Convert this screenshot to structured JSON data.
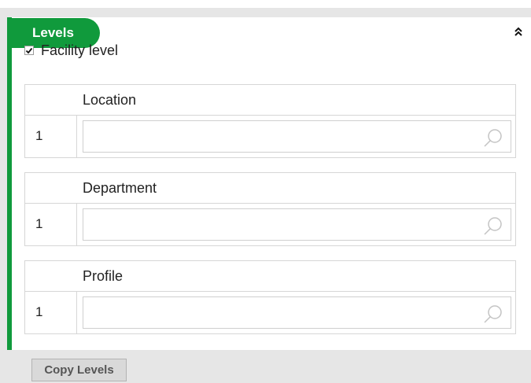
{
  "panel": {
    "title": "Levels",
    "collapse_icon": "double-chevron-up-icon"
  },
  "facility_level": {
    "label": "Facility level",
    "checked": true
  },
  "levels": [
    {
      "header": "Location",
      "row_number": "1",
      "value": "",
      "search_icon": "search-icon"
    },
    {
      "header": "Department",
      "row_number": "1",
      "value": "",
      "search_icon": "search-icon"
    },
    {
      "header": "Profile",
      "row_number": "1",
      "value": "",
      "search_icon": "search-icon"
    }
  ],
  "footer": {
    "copy_levels_label": "Copy Levels"
  },
  "colors": {
    "accent": "#109a3c",
    "background": "#e6e6e6",
    "border": "#d6d6d6"
  }
}
